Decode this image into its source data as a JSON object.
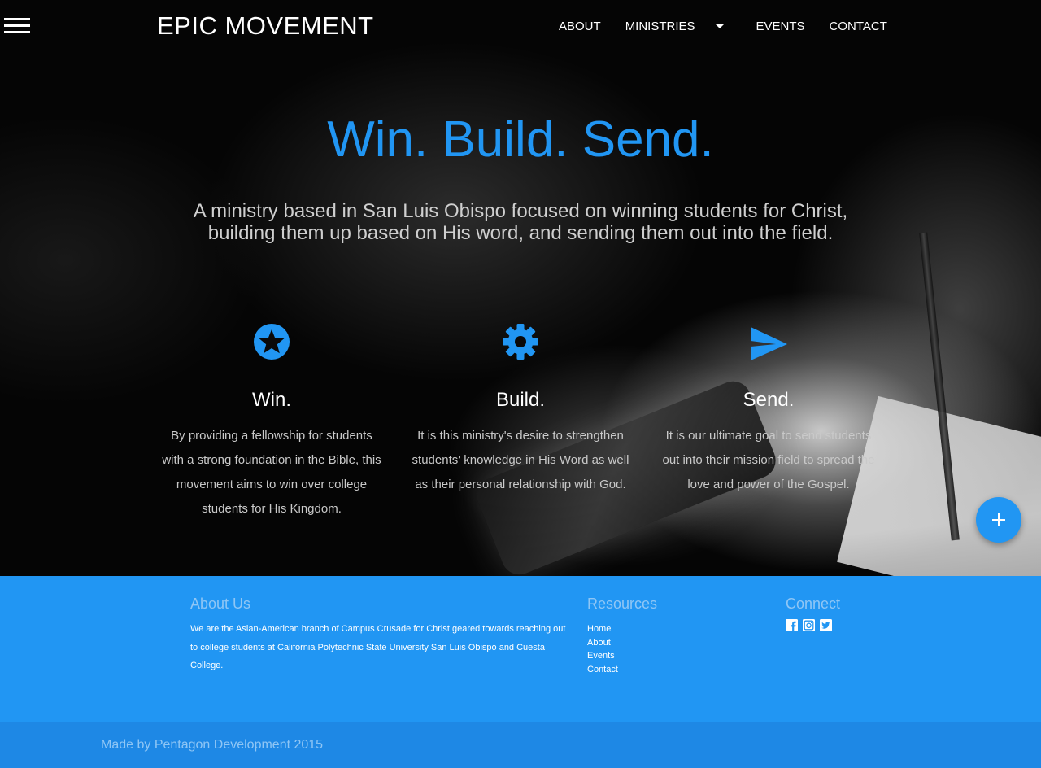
{
  "nav": {
    "brand": "EPIC MOVEMENT",
    "links": [
      "ABOUT",
      "MINISTRIES",
      "EVENTS",
      "CONTACT"
    ]
  },
  "hero": {
    "title": "Win. Build. Send.",
    "subtitle": "A ministry based in San Luis Obispo focused on winning students for Christ, building them up based on His word, and sending them out into the field."
  },
  "features": [
    {
      "icon": "star-circle-icon",
      "title": "Win.",
      "text": "By providing a fellowship for students with a strong foundation in the Bible, this movement aims to win over college students for His Kingdom."
    },
    {
      "icon": "gear-icon",
      "title": "Build.",
      "text": "It is this ministry's desire to strengthen students' knowledge in His Word as well as their personal relationship with God."
    },
    {
      "icon": "send-icon",
      "title": "Send.",
      "text": "It is our ultimate goal to send students out into their mission field to spread the love and power of the Gospel."
    }
  ],
  "fab": {
    "icon": "plus-icon"
  },
  "footer": {
    "about": {
      "heading": "About Us",
      "text": "We are the Asian-American branch of Campus Crusade for Christ geared towards reaching out to college students at California Polytechnic State University San Luis Obispo and Cuesta College."
    },
    "resources": {
      "heading": "Resources",
      "links": [
        "Home",
        "About",
        "Events",
        "Contact"
      ]
    },
    "connect": {
      "heading": "Connect",
      "icons": [
        "facebook-icon",
        "instagram-icon",
        "twitter-icon"
      ]
    },
    "copyright": "Made by Pentagon Development 2015"
  },
  "colors": {
    "accent": "#2196f3",
    "footer_bg": "#2196f3",
    "copyright_bg": "#1e88e5",
    "footer_heading": "#8fc6f5"
  }
}
